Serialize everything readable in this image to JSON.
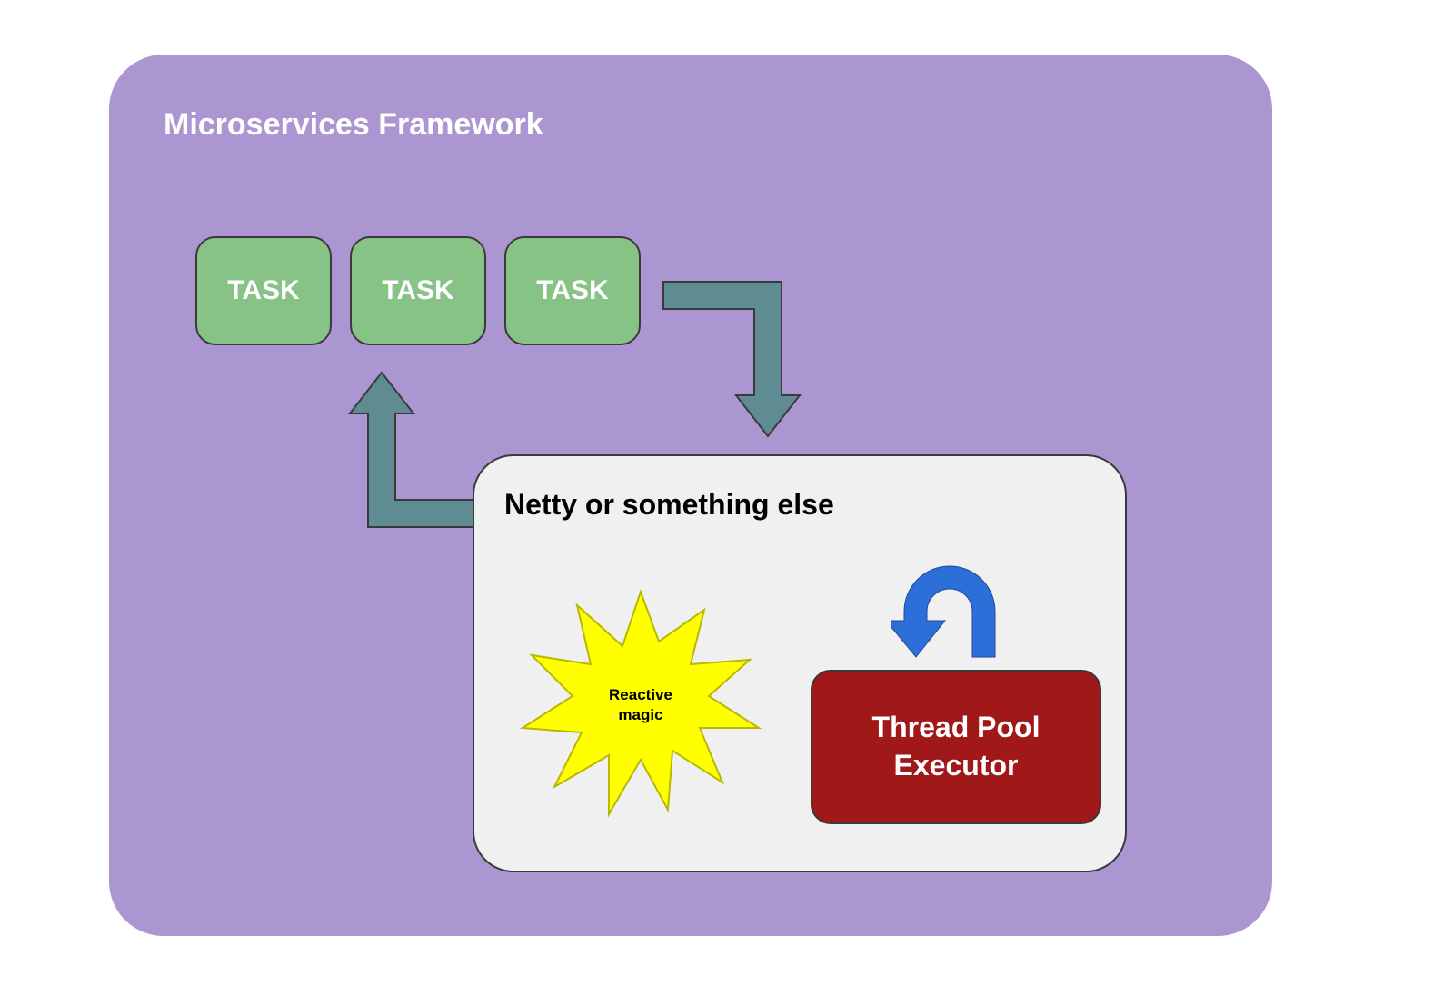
{
  "framework": {
    "title": "Microservices Framework"
  },
  "tasks": [
    {
      "label": "TASK"
    },
    {
      "label": "TASK"
    },
    {
      "label": "TASK"
    }
  ],
  "netty": {
    "title": "Netty or something else"
  },
  "threadpool": {
    "label": "Thread Pool\nExecutor"
  },
  "starburst": {
    "label": "Reactive\nmagic"
  },
  "colors": {
    "framework_bg": "#ab96d2",
    "task_bg": "#87c287",
    "netty_bg": "#f0f0f0",
    "threadpool_bg": "#a01818",
    "starburst_bg": "#ffff00",
    "arrow_teal": "#5f8b93",
    "arrow_blue": "#2d6fd8"
  },
  "chart_data": {
    "type": "diagram",
    "title": "Microservices Framework",
    "nodes": [
      {
        "id": "framework",
        "label": "Microservices Framework",
        "type": "container"
      },
      {
        "id": "task1",
        "label": "TASK",
        "type": "box",
        "parent": "framework"
      },
      {
        "id": "task2",
        "label": "TASK",
        "type": "box",
        "parent": "framework"
      },
      {
        "id": "task3",
        "label": "TASK",
        "type": "box",
        "parent": "framework"
      },
      {
        "id": "netty",
        "label": "Netty or something else",
        "type": "container",
        "parent": "framework"
      },
      {
        "id": "reactive",
        "label": "Reactive magic",
        "type": "starburst",
        "parent": "netty"
      },
      {
        "id": "threadpool",
        "label": "Thread Pool Executor",
        "type": "box",
        "parent": "netty"
      }
    ],
    "edges": [
      {
        "from": "task3",
        "to": "netty",
        "style": "elbow-arrow"
      },
      {
        "from": "netty",
        "to": "task2",
        "style": "elbow-arrow"
      },
      {
        "from": "threadpool",
        "to": "threadpool",
        "style": "curved-self-loop"
      }
    ]
  }
}
